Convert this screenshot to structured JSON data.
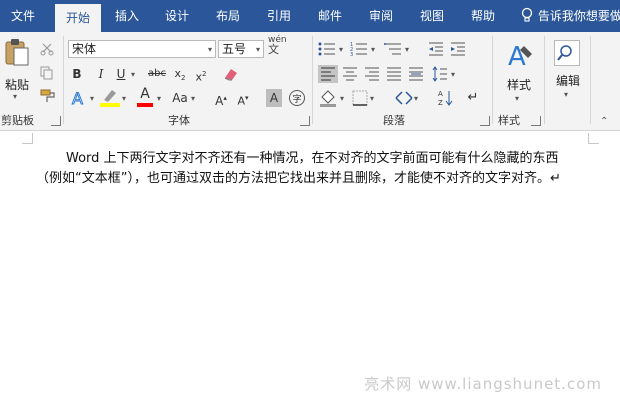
{
  "tabs": [
    "文件",
    "开始",
    "插入",
    "设计",
    "布局",
    "引用",
    "邮件",
    "审阅",
    "视图",
    "帮助"
  ],
  "tell_me": "告诉我你想要做",
  "clipboard": {
    "paste": "粘贴",
    "group": "剪贴板"
  },
  "font": {
    "name": "宋体",
    "size": "五号",
    "phonetic": "wén",
    "group": "字体",
    "change_case": "Aa",
    "grow": "A",
    "shrink": "A"
  },
  "paragraph": {
    "group": "段落"
  },
  "styles": {
    "label": "样式",
    "group": "样式"
  },
  "editing": {
    "label": "编辑"
  },
  "colors": {
    "accent": "#2b579a",
    "highlight": "#ffff00",
    "font_color": "#ff0000"
  },
  "document": {
    "paragraph": "Word 上下两行文字对不齐还有一种情况，在不对齐的文字前面可能有什么隐藏的东西（例如“文本框”），也可通过双击的方法把它找出来并且删除，才能使不对齐的文字对齐。↵"
  },
  "watermark": "亮术网 www.liangshunet.com"
}
